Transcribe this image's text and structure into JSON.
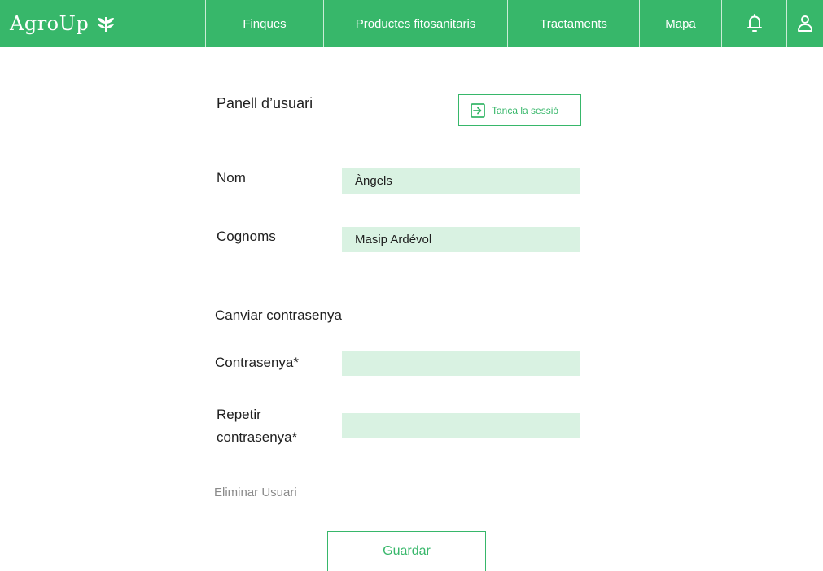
{
  "nav": {
    "brand": "AgroUp",
    "items": [
      {
        "label": "Finques"
      },
      {
        "label": "Productes fitosanitaris"
      },
      {
        "label": "Tractaments"
      },
      {
        "label": "Mapa"
      }
    ],
    "icons": [
      "bell-icon",
      "user-icon"
    ]
  },
  "panel": {
    "title": "Panell d’usuari",
    "logout_label": "Tanca la sessió",
    "logout_icon": "logout-icon"
  },
  "form": {
    "name_label": "Nom",
    "name_value": "Àngels",
    "surname_label": "Cognoms",
    "surname_value": "Masip Ardévol",
    "change_password_title": "Canviar contrasenya",
    "password_label": "Contrasenya*",
    "password_value": "",
    "repeat_password_label_line1": "Repetir",
    "repeat_password_label_line2": "contrasenya*",
    "repeat_password_value": "",
    "delete_user": "Eliminar Usuari",
    "save_label": "Guardar"
  },
  "colors": {
    "accent": "#37b76a",
    "field_bg": "#d9f2e2",
    "muted": "#8a8a8a"
  }
}
